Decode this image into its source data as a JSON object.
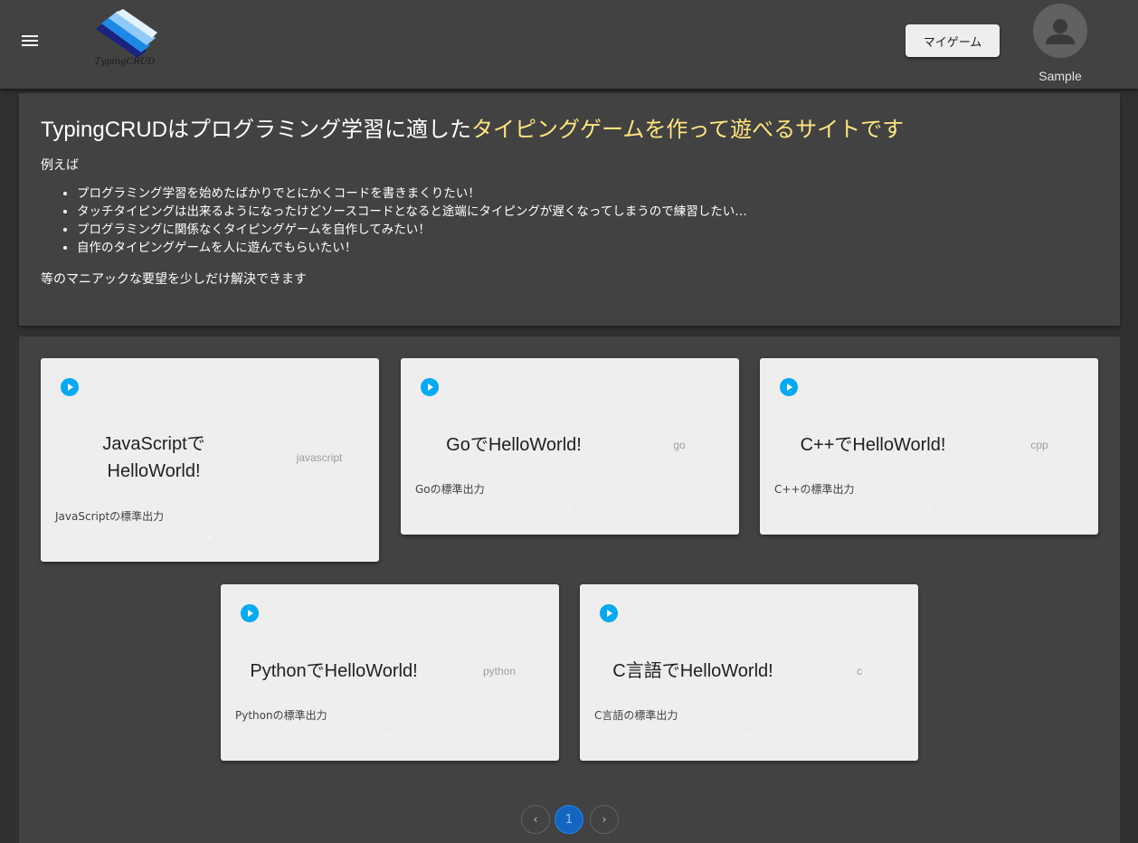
{
  "header": {
    "logo_text": "TypingCRUD",
    "my_game_label": "マイゲーム",
    "user_name": "Sample"
  },
  "intro": {
    "title_plain": "TypingCRUDはプログラミング学習に適した",
    "title_highlight": "タイピングゲームを作って遊べるサイトです",
    "lead": "例えば",
    "items": [
      "プログラミング学習を始めたばかりでとにかくコードを書きまくりたい！",
      "タッチタイピングは出来るようになったけどソースコードとなると途端にタイピングが遅くなってしまうので練習したい…",
      "プログラミングに関係なくタイピングゲームを自作してみたい！",
      "自作のタイピングゲームを人に遊んでもらいたい！"
    ],
    "closing": "等のマニアックな要望を少しだけ解決できます"
  },
  "games": [
    {
      "title_line1": "JavaScriptで",
      "title_line2": "HelloWorld!",
      "lang": "javascript",
      "desc": "JavaScriptの標準出力"
    },
    {
      "title_line1": "GoでHelloWorld!",
      "title_line2": "",
      "lang": "go",
      "desc": "Goの標準出力"
    },
    {
      "title_line1": "C++でHelloWorld!",
      "title_line2": "",
      "lang": "cpp",
      "desc": "C++の標準出力"
    },
    {
      "title_line1": "PythonでHelloWorld!",
      "title_line2": "",
      "lang": "python",
      "desc": "Pythonの標準出力"
    },
    {
      "title_line1": "C言語でHelloWorld!",
      "title_line2": "",
      "lang": "c",
      "desc": "C言語の標準出力"
    }
  ],
  "pagination": {
    "prev_label": "‹",
    "current_page": "1",
    "next_label": "›"
  },
  "colors": {
    "background": "#303030",
    "panel": "#424242",
    "highlight": "#ffe57f",
    "play_icon": "#03a9f4",
    "card": "#eeeeee"
  }
}
